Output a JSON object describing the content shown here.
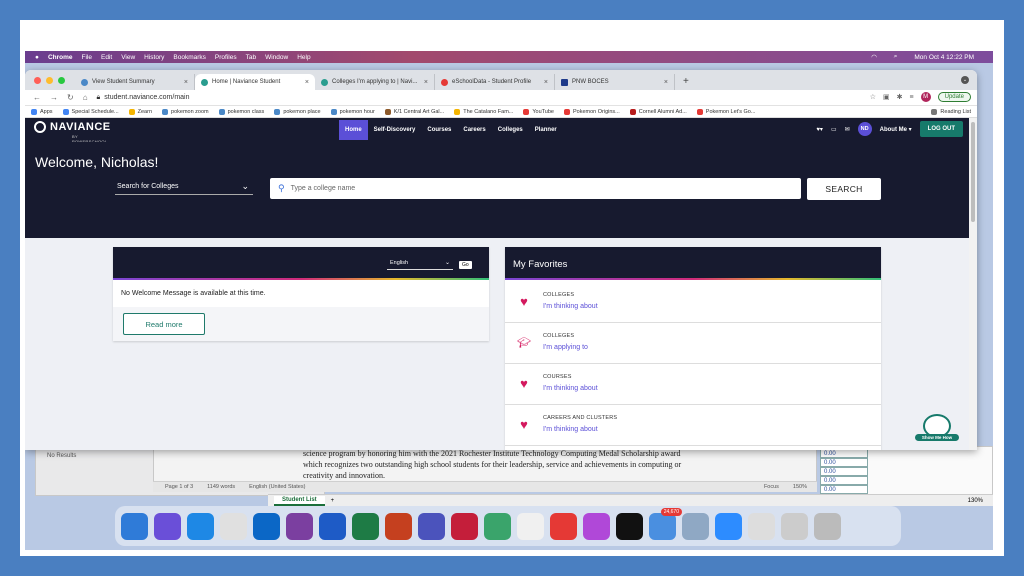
{
  "menubar": {
    "app": "Chrome",
    "items": [
      "File",
      "Edit",
      "View",
      "History",
      "Bookmarks",
      "Profiles",
      "Tab",
      "Window",
      "Help"
    ],
    "clock": "Mon Oct 4  12:22 PM"
  },
  "browser": {
    "tabs": [
      {
        "label": "View Student Summary"
      },
      {
        "label": "Home | Naviance Student"
      },
      {
        "label": "Colleges I'm applying to | Navi..."
      },
      {
        "label": "eSchoolData - Student Profile"
      },
      {
        "label": "PNW BOCES"
      }
    ],
    "url": "student.naviance.com/main",
    "update_label": "Update",
    "profile_initial": "M",
    "bookmarks": [
      {
        "label": "Apps",
        "color": "#4285f4"
      },
      {
        "label": "Special Schedule...",
        "color": "#4285f4"
      },
      {
        "label": "Zearn",
        "color": "#f4b400"
      },
      {
        "label": "pokemon zoom",
        "color": "#4a88c7"
      },
      {
        "label": "pokemon class",
        "color": "#4a88c7"
      },
      {
        "label": "pokemon place",
        "color": "#4a88c7"
      },
      {
        "label": "pokemon hour",
        "color": "#4a88c7"
      },
      {
        "label": "K/1 Central Art Gal...",
        "color": "#8d5a2b"
      },
      {
        "label": "The Catalano Fam...",
        "color": "#f4b400"
      },
      {
        "label": "YouTube",
        "color": "#e53935"
      },
      {
        "label": "Pokemon Origins...",
        "color": "#e53935"
      },
      {
        "label": "Cornell Alumni Ad...",
        "color": "#b71c1c"
      },
      {
        "label": "Pokemon Let's Go...",
        "color": "#e53935"
      }
    ],
    "reading_list": "Reading List"
  },
  "naviance": {
    "logo": "NAVIANCE",
    "logo_sub": "BY POWERSCHOOL",
    "nav": [
      "Home",
      "Self-Discovery",
      "Courses",
      "Careers",
      "Colleges",
      "Planner"
    ],
    "initials": "ND",
    "about_me": "About Me ▾",
    "logout": "LOG OUT",
    "welcome": "Welcome, Nicholas!",
    "search_select": "Search for Colleges",
    "search_placeholder": "Type a college name",
    "search_button": "SEARCH",
    "welcome_card": {
      "language": "English",
      "go": "Go",
      "message": "No Welcome Message is available at this time.",
      "read_more": "Read more"
    },
    "favorites": {
      "title": "My Favorites",
      "items": [
        {
          "category": "COLLEGES",
          "link": "I'm thinking about",
          "icon": "heart-icon"
        },
        {
          "category": "COLLEGES",
          "link": "I'm applying to",
          "icon": "graduation-cap-icon"
        },
        {
          "category": "COURSES",
          "link": "I'm thinking about",
          "icon": "heart-icon"
        },
        {
          "category": "CAREERS AND CLUSTERS",
          "link": "I'm thinking about",
          "icon": "heart-icon"
        }
      ]
    },
    "show_me_how": "Show Me How"
  },
  "background": {
    "no_results": "No Results",
    "doc_text": "science program by honoring him with the 2021 Rochester Institute Technology Computing Medal Scholarship award which recognizes two outstanding high school students for their leadership, service and achievements in computing or creativity and innovation.",
    "status": [
      "Page 1 of 3",
      "1149 words",
      "English (United States)",
      "Focus",
      "150%"
    ],
    "sheet_tab": "Student List",
    "sheet_zoom": "130%",
    "cells": [
      "0.00",
      "0.00",
      "0.00",
      "0.00",
      "0.00"
    ]
  },
  "dock": {
    "mail_badge": "24,670",
    "colors": [
      "#2f7bd8",
      "#6a4fd8",
      "#1e88e5",
      "#e0e0e0",
      "#0b67c6",
      "#7b3fa0",
      "#1e5bc6",
      "#1e7b45",
      "#c5401f",
      "#4b53bc",
      "#c41e3a",
      "#3aa46b",
      "#f0f0f0",
      "#e53935",
      "#b048d8",
      "#111111",
      "#4a8fe0",
      "#8fa8c4",
      "#2d8cff",
      "#dddddd",
      "#cccccc",
      "#bbbbbb"
    ]
  }
}
